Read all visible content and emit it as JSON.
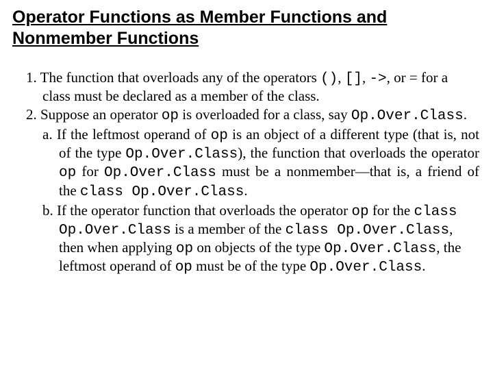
{
  "title": "Operator Functions as Member Functions and Nonmember Functions",
  "item1": {
    "t1": "1. The function that overloads any of the operators ",
    "c1": "()",
    "t2": ",   ",
    "c2": "[]",
    "t3": ",   ",
    "c3": "->",
    "t4": ", or =  for a class must be declared as a member of the class."
  },
  "item2": {
    "t1": "2. Suppose an operator ",
    "c1": "op",
    "t2": " is overloaded for a class, say ",
    "c2": "Op.Over.Class",
    "t3": "."
  },
  "suba": {
    "t1": "a. If the leftmost operand of ",
    "c1": "op",
    "t2": " is an object of a different type (that is, not of the type ",
    "c2": "Op.Over.Class",
    "t3": "), the function that overloads the operator ",
    "c3": "op",
    "t4": " for ",
    "c4": "Op.Over.Class",
    "t5": " must be a nonmember—that is, a friend of the ",
    "c5": "class Op.Over.Class",
    "t6": "."
  },
  "subb": {
    "t1": "b. If the operator function that overloads the operator ",
    "c1": "op",
    "t2": " for the ",
    "c2": "class Op.Over.Class",
    "t3": " is a member of the ",
    "c3": "class Op.Over.Class",
    "t4": ", then when applying ",
    "c4": "op",
    "t5": " on objects of the type ",
    "c5": "Op.Over.Class",
    "t6": ", the leftmost operand of ",
    "c6": "op",
    "t7": " must be of the type ",
    "c7": "Op.Over.Class",
    "t8": "."
  }
}
